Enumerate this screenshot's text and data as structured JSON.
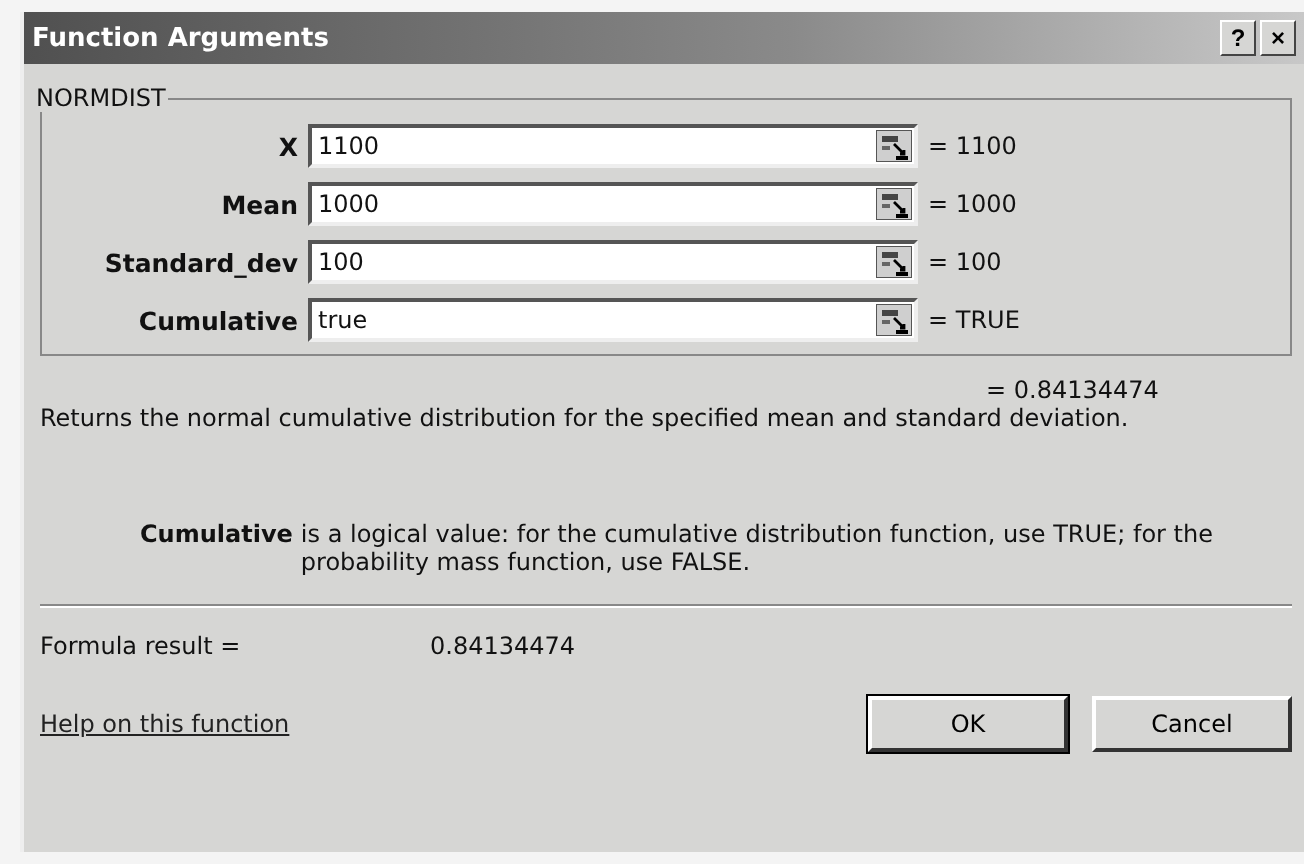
{
  "window": {
    "title": "Function Arguments",
    "help_button": "?",
    "close_button": "×"
  },
  "function": {
    "name": "NORMDIST",
    "arguments": [
      {
        "name": "X",
        "value": "1100",
        "result": "= 1100"
      },
      {
        "name": "Mean",
        "value": "1000",
        "result": "= 1000"
      },
      {
        "name": "Standard_dev",
        "value": "100",
        "result": "= 100"
      },
      {
        "name": "Cumulative",
        "value": "true",
        "result": "= TRUE"
      }
    ],
    "result": "= 0.84134474",
    "description": "Returns the normal cumulative distribution for the specified mean and standard deviation.",
    "argument_help": {
      "name": "Cumulative",
      "text": "is a logical value: for the cumulative distribution function, use TRUE; for the probability mass function, use FALSE."
    }
  },
  "formula_result": {
    "label": "Formula result =",
    "value": "0.84134474"
  },
  "help_link": "Help on this function",
  "buttons": [
    "OK",
    "Cancel"
  ]
}
